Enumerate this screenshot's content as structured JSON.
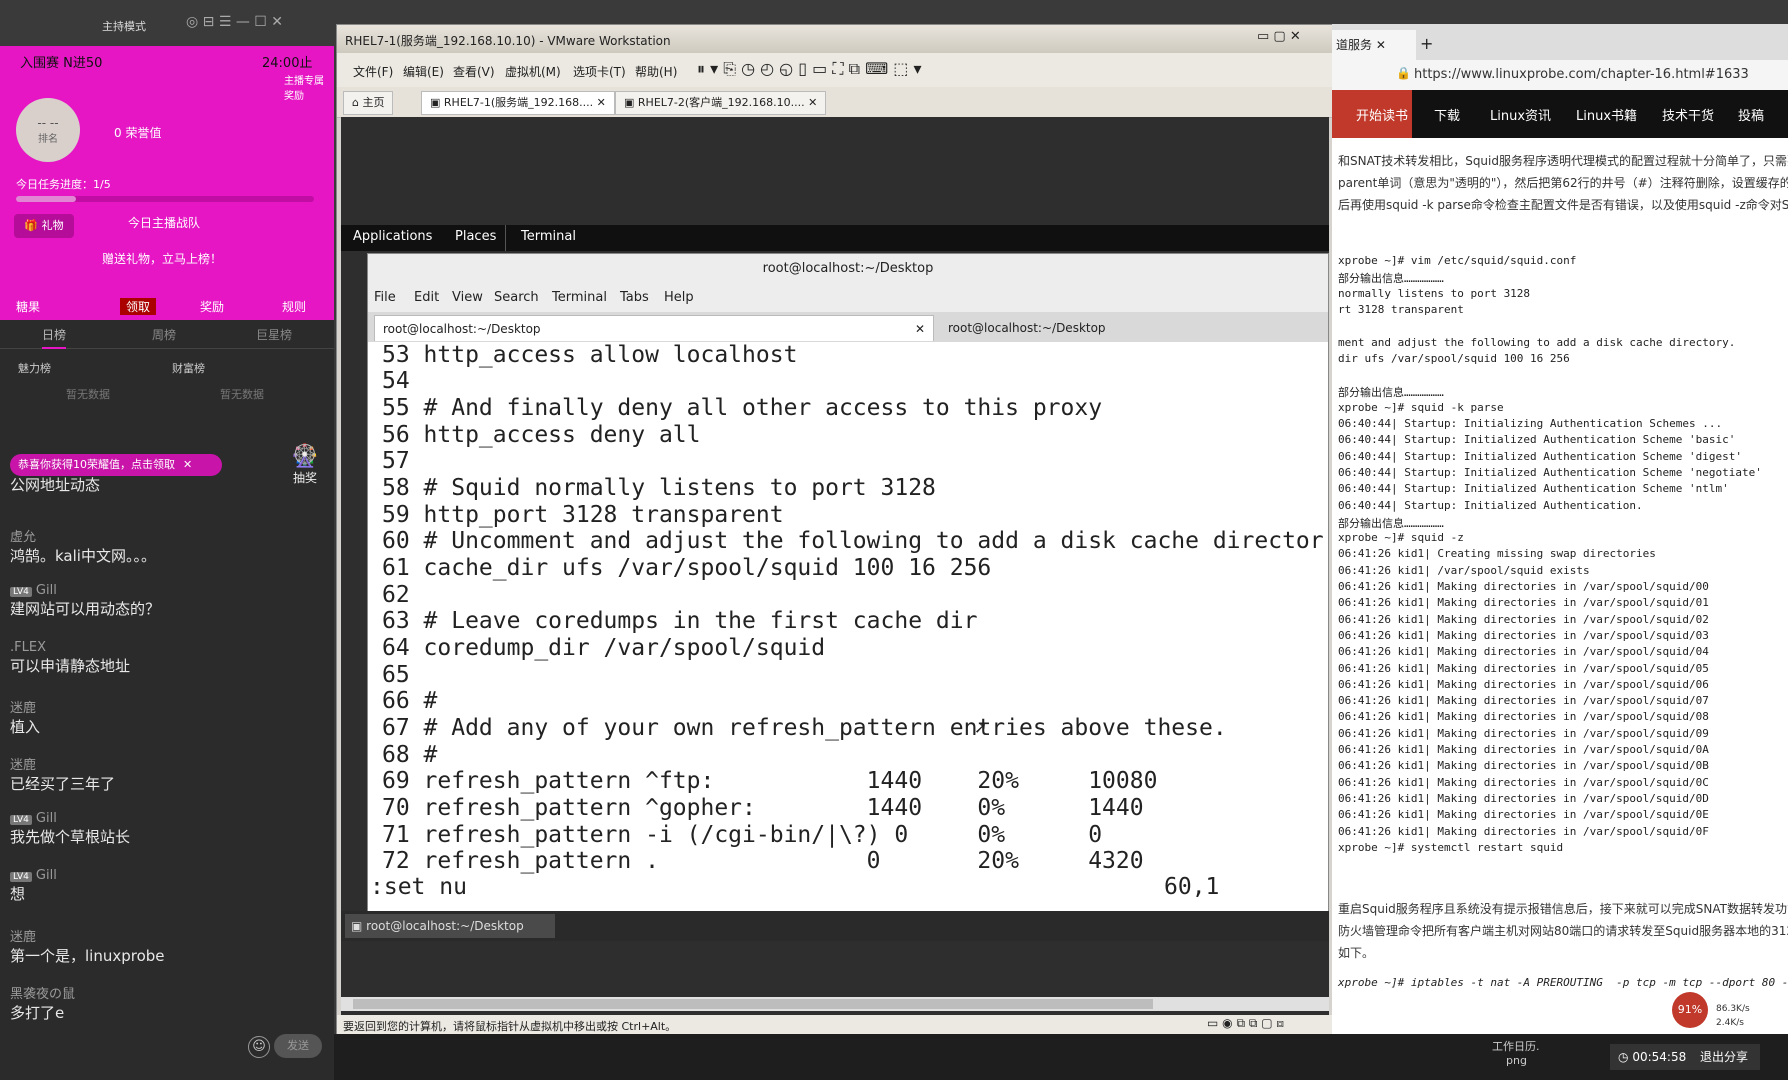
{
  "live": {
    "mode_title": "主持模式",
    "rank_label": "入围赛 N进50",
    "timer": "24:00止",
    "avatar_text": "-- --",
    "avatar_sub": "排名",
    "honor": "0 荣誉值",
    "task_progress": "今日任务进度：1/5",
    "gift_btn": "礼物",
    "today_team": "今日主播战队",
    "gift_slogan": "赠送礼物，立马上榜！",
    "promo_badge": "主播专属奖励",
    "tabs": [
      "日榜",
      "周榜",
      "巨星榜"
    ],
    "rank_tabs": [
      "魅力榜",
      "财富榜"
    ],
    "no_data": [
      "暂无数据",
      "暂无数据"
    ],
    "pink_btns": [
      "糖果",
      "领取",
      "奖励",
      "规则"
    ],
    "notice": "恭喜你获得10荣耀值，点击领取",
    "lottery": "抽奖",
    "messages": [
      {
        "user": "",
        "text": "公网地址动态"
      },
      {
        "user": "虚允",
        "text": "鸿鹄。kali中文网。。。"
      },
      {
        "user": "Gill",
        "lv": "LV4",
        "text": "建网站可以用动态的？"
      },
      {
        "user": ".FLEX",
        "text": "可以申请静态地址"
      },
      {
        "user": "迷鹿",
        "text": "植入"
      },
      {
        "user": "迷鹿",
        "text": "已经买了三年了"
      },
      {
        "user": "Gill",
        "lv": "LV4",
        "text": "我先做个草根站长"
      },
      {
        "user": "Gill",
        "lv": "LV4",
        "text": "想"
      },
      {
        "user": "迷鹿",
        "text": "第一个是，linuxprobe"
      },
      {
        "user": "黑袭夜の鼠",
        "text": "多打了e"
      }
    ],
    "send_btn": "发送"
  },
  "vmware": {
    "title": "RHEL7-1(服务端_192.168.10.10) - VMware Workstation",
    "menu": [
      "文件(F)",
      "编辑(E)",
      "查看(V)",
      "虚拟机(M)",
      "选项卡(T)",
      "帮助(H)"
    ],
    "tabs": [
      "主页",
      "RHEL7-1(服务端_192.168....",
      "RHEL7-2(客户端_192.168.10...."
    ],
    "gnome": {
      "apps": "Applications",
      "places": "Places",
      "terminal": "Terminal"
    },
    "status": "要返回到您的计算机，请将鼠标指针从虚拟机中移出或按 Ctrl+Alt。",
    "taskbar_item": "root@localhost:~/Desktop"
  },
  "terminal": {
    "title": "root@localhost:~/Desktop",
    "menu": [
      "File",
      "Edit",
      "View",
      "Search",
      "Terminal",
      "Tabs",
      "Help"
    ],
    "tab1": "root@localhost:~/Desktop",
    "tab2": "root@localhost:~/Desktop",
    "lines": [
      "53 http_access allow localhost",
      "54",
      "55 # And finally deny all other access to this proxy",
      "56 http_access deny all",
      "57",
      "58 # Squid normally listens to port 3128",
      "59 http_port 3128 transparent",
      "60 # Uncomment and adjust the following to add a disk cache director",
      "61 cache_dir ufs /var/spool/squid 100 16 256",
      "62",
      "63 # Leave coredumps in the first cache dir",
      "64 coredump_dir /var/spool/squid",
      "65",
      "66 #",
      "67 # Add any of your own refresh_pattern entries above these.",
      "68 #",
      "69 refresh_pattern ^ftp:           1440    20%     10080",
      "70 refresh_pattern ^gopher:        1440    0%      1440",
      "71 refresh_pattern -i (/cgi-bin/|\\?) 0     0%      0",
      "72 refresh_pattern .               0       20%     4320"
    ],
    "cmdline": ":set nu",
    "position": "60,1"
  },
  "browser": {
    "tab_label": "道服务",
    "url": "https://www.linuxprobe.com/chapter-16.html#1633",
    "nav": [
      "开始读书",
      "下载",
      "Linux资讯",
      "Linux书籍",
      "技术干货",
      "投稿"
    ],
    "intro": [
      "和SNAT技术转发相比，Squid服务程序透明代理模式的配置过程就十分简单了，只需要在主",
      "parent单词（意思为\"透明的\"），然后把第62行的井号（#）注释符删除，设置缓存的保",
      "后再使用squid -k parse命令检查主配置文件是否有错误，以及使用squid -z命令对Squid服"
    ],
    "code": [
      "xprobe ~]# vim /etc/squid/squid.conf",
      "部分输出信息………………",
      "normally listens to port 3128",
      "rt 3128 transparent",
      "",
      "ment and adjust the following to add a disk cache directory.",
      "dir ufs /var/spool/squid 100 16 256",
      "",
      "部分输出信息………………",
      "xprobe ~]# squid -k parse",
      "06:40:44| Startup: Initializing Authentication Schemes ...",
      "06:40:44| Startup: Initialized Authentication Scheme 'basic'",
      "06:40:44| Startup: Initialized Authentication Scheme 'digest'",
      "06:40:44| Startup: Initialized Authentication Scheme 'negotiate'",
      "06:40:44| Startup: Initialized Authentication Scheme 'ntlm'",
      "06:40:44| Startup: Initialized Authentication.",
      "部分输出信息………………",
      "xprobe ~]# squid -z",
      "06:41:26 kid1| Creating missing swap directories",
      "06:41:26 kid1| /var/spool/squid exists",
      "06:41:26 kid1| Making directories in /var/spool/squid/00",
      "06:41:26 kid1| Making directories in /var/spool/squid/01",
      "06:41:26 kid1| Making directories in /var/spool/squid/02",
      "06:41:26 kid1| Making directories in /var/spool/squid/03",
      "06:41:26 kid1| Making directories in /var/spool/squid/04",
      "06:41:26 kid1| Making directories in /var/spool/squid/05",
      "06:41:26 kid1| Making directories in /var/spool/squid/06",
      "06:41:26 kid1| Making directories in /var/spool/squid/07",
      "06:41:26 kid1| Making directories in /var/spool/squid/08",
      "06:41:26 kid1| Making directories in /var/spool/squid/09",
      "06:41:26 kid1| Making directories in /var/spool/squid/0A",
      "06:41:26 kid1| Making directories in /var/spool/squid/0B",
      "06:41:26 kid1| Making directories in /var/spool/squid/0C",
      "06:41:26 kid1| Making directories in /var/spool/squid/0D",
      "06:41:26 kid1| Making directories in /var/spool/squid/0E",
      "06:41:26 kid1| Making directories in /var/spool/squid/0F",
      "xprobe ~]# systemctl restart squid"
    ],
    "outro": [
      "重启Squid服务程序且系统没有提示报错信息后，接下来就可以完成SNAT数据转发功能了",
      "防火墙管理命令把所有客户端主机对网站80端口的请求转发至Squid服务器本地的3128端",
      "如下。"
    ],
    "iptables": "xprobe ~]# iptables -t nat -A PREROUTING  -p tcp -m tcp --dport 80 -j"
  },
  "tray": {
    "cpu": "91%",
    "up": "86.3K/s",
    "down": "2.4K/s",
    "time": "00:54:58",
    "exit_share": "退出分享",
    "files": [
      "工作日历.",
      "png"
    ]
  },
  "colors": {
    "pink": "#e616c4",
    "terminal_bg": "#ffffff",
    "nav_bg": "#111111"
  }
}
